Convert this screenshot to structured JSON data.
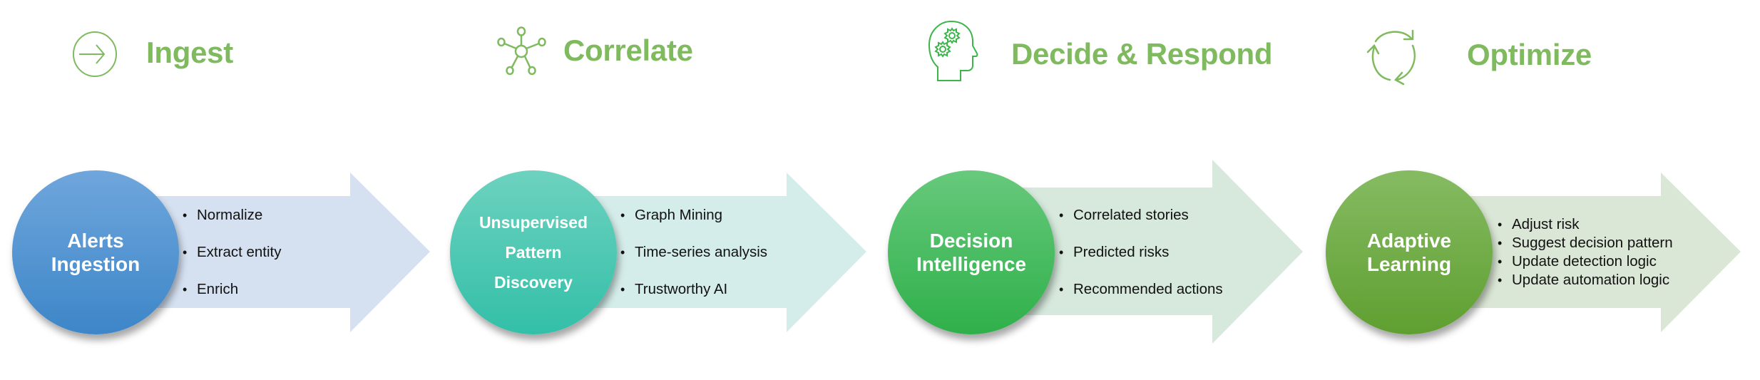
{
  "colors": {
    "header_green": "#7fba5f",
    "head_icon_green": "#3cb54a"
  },
  "stages": [
    {
      "header": {
        "title": "Ingest",
        "icon": "arrow-in-circle-icon"
      },
      "circle": {
        "label": "Alerts\nIngestion",
        "color_top": "#6fa6dc",
        "color_bottom": "#3d86c8"
      },
      "arrow_color": "#d5e1f1",
      "bullets": [
        "Normalize",
        "Extract entity",
        "Enrich"
      ]
    },
    {
      "header": {
        "title": "Correlate",
        "icon": "network-nodes-icon"
      },
      "circle": {
        "label": "Unsupervised\nPattern\nDiscovery",
        "color_top": "#6dd2bf",
        "color_bottom": "#33bfa8"
      },
      "arrow_color": "#d5edea",
      "bullets": [
        "Graph Mining",
        "Time-series analysis",
        "Trustworthy AI"
      ]
    },
    {
      "header": {
        "title": "Decide & Respond",
        "icon": "head-gears-icon"
      },
      "circle": {
        "label": "Decision\nIntelligence",
        "color_top": "#67c97c",
        "color_bottom": "#2fb04a"
      },
      "arrow_color": "#d6e9dc",
      "bullets": [
        "Correlated stories",
        "Predicted risks",
        "Recommended actions"
      ]
    },
    {
      "header": {
        "title": "Optimize",
        "icon": "cycle-arrows-icon"
      },
      "circle": {
        "label": "Adaptive\nLearning",
        "color_top": "#86bb63",
        "color_bottom": "#5f9f30"
      },
      "arrow_color": "#dbe7d6",
      "bullets": [
        "Adjust risk",
        "Suggest decision pattern",
        "Update detection logic",
        "Update automation logic"
      ]
    }
  ]
}
